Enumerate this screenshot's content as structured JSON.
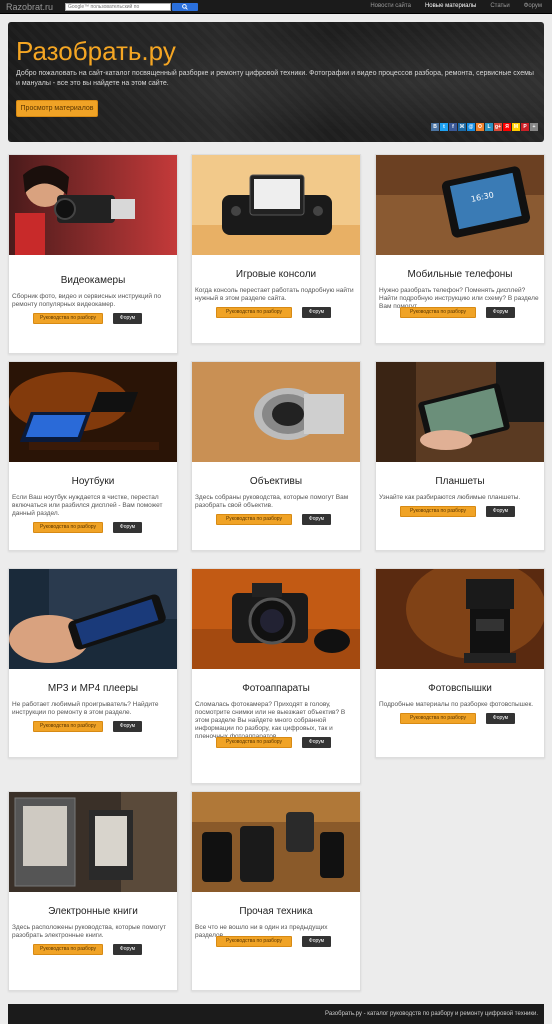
{
  "navbar": {
    "brand": "Razobrat.ru",
    "search_placeholder": "Google™ пользовательский по",
    "links": [
      "Новости сайта",
      "Новые материалы",
      "Статьи",
      "Форум"
    ],
    "active_link": 1
  },
  "hero": {
    "title": "Разобрать.ру",
    "text": "Добро пожаловать на сайт-каталог посвященный разборке и ремонту цифровой техники. Фотографии и видео процессов разбора, ремонта, сервисные схемы и мануалы - все это вы найдете на этом сайте.",
    "button": "Просмотр материалов",
    "share_icons": [
      "vk-icon",
      "twitter-icon",
      "facebook-icon",
      "livejournal-icon",
      "mailru-icon",
      "odnoklassniki-icon",
      "liveinternet-icon",
      "google-icon",
      "yandex-icon",
      "moikrug-icon",
      "pinterest-icon",
      "more-icon"
    ],
    "share_colors": [
      "#4c75a3",
      "#1da1f2",
      "#3b5998",
      "#1d6aa5",
      "#168de2",
      "#ed812b",
      "#2a93c1",
      "#dd4b39",
      "#ff0000",
      "#ffcc00",
      "#cb2027",
      "#888888"
    ]
  },
  "cards": [
    {
      "title": "Видеокамеры",
      "desc": "Сборник фото, видео и сервисных инструкций по ремонту популярных видеокамер.",
      "guide": "Руководства по разбору",
      "forum": "Форум"
    },
    {
      "title": "Игровые консоли",
      "desc": "Когда консоль перестает работать подробную найти нужный в этом разделе сайта.",
      "guide": "Руководства по разбору",
      "forum": "Форум"
    },
    {
      "title": "Мобильные телефоны",
      "desc": "Нужно разобрать телефон? Поменять дисплей? Найти подробную инструкцию или схему? В разделе Вам помогут.",
      "guide": "Руководства по разбору",
      "forum": "Форум"
    },
    {
      "title": "Ноутбуки",
      "desc": "Если Ваш ноутбук нуждается в чистке, перестал включаться или разбился дисплей - Вам поможет данный раздел.",
      "guide": "Руководства по разбору",
      "forum": "Форум"
    },
    {
      "title": "Объективы",
      "desc": "Здесь собраны руководства, которые помогут Вам разобрать свой объектив.",
      "guide": "Руководства по разбору",
      "forum": "Форум"
    },
    {
      "title": "Планшеты",
      "desc": "Узнайте как разбираются любимые планшеты.",
      "guide": "Руководства по разбору",
      "forum": "Форум"
    },
    {
      "title": "MP3 и MP4 плееры",
      "desc": "Не работает любимый проигрыватель? Найдите инструкции по ремонту в этом разделе.",
      "guide": "Руководства по разбору",
      "forum": "Форум"
    },
    {
      "title": "Фотоаппараты",
      "desc": "Сломалась фотокамера? Приходят в голову, посмотрите снимки или не выезжает объектив? В этом разделе Вы найдете много собранной информации по разбору, как цифровых, так и пленочных фотоаппаратов.",
      "guide": "Руководства по разбору",
      "forum": "Форум"
    },
    {
      "title": "Фотовспышки",
      "desc": "Подробные материалы по разборке фотовспышек.",
      "guide": "Руководства по разбору",
      "forum": "Форум"
    },
    {
      "title": "Электронные книги",
      "desc": "Здесь расположены руководства, которые помогут разобрать электронные книги.",
      "guide": "Руководства по разбору",
      "forum": "Форум"
    },
    {
      "title": "Прочая техника",
      "desc": "Все что не вошло ни в один из предыдущих разделов.",
      "guide": "Руководства по разбору",
      "forum": "Форум"
    }
  ],
  "footer": {
    "text": "Разобрать.ру - каталог руководств по разбору и ремонту цифровой техники."
  }
}
